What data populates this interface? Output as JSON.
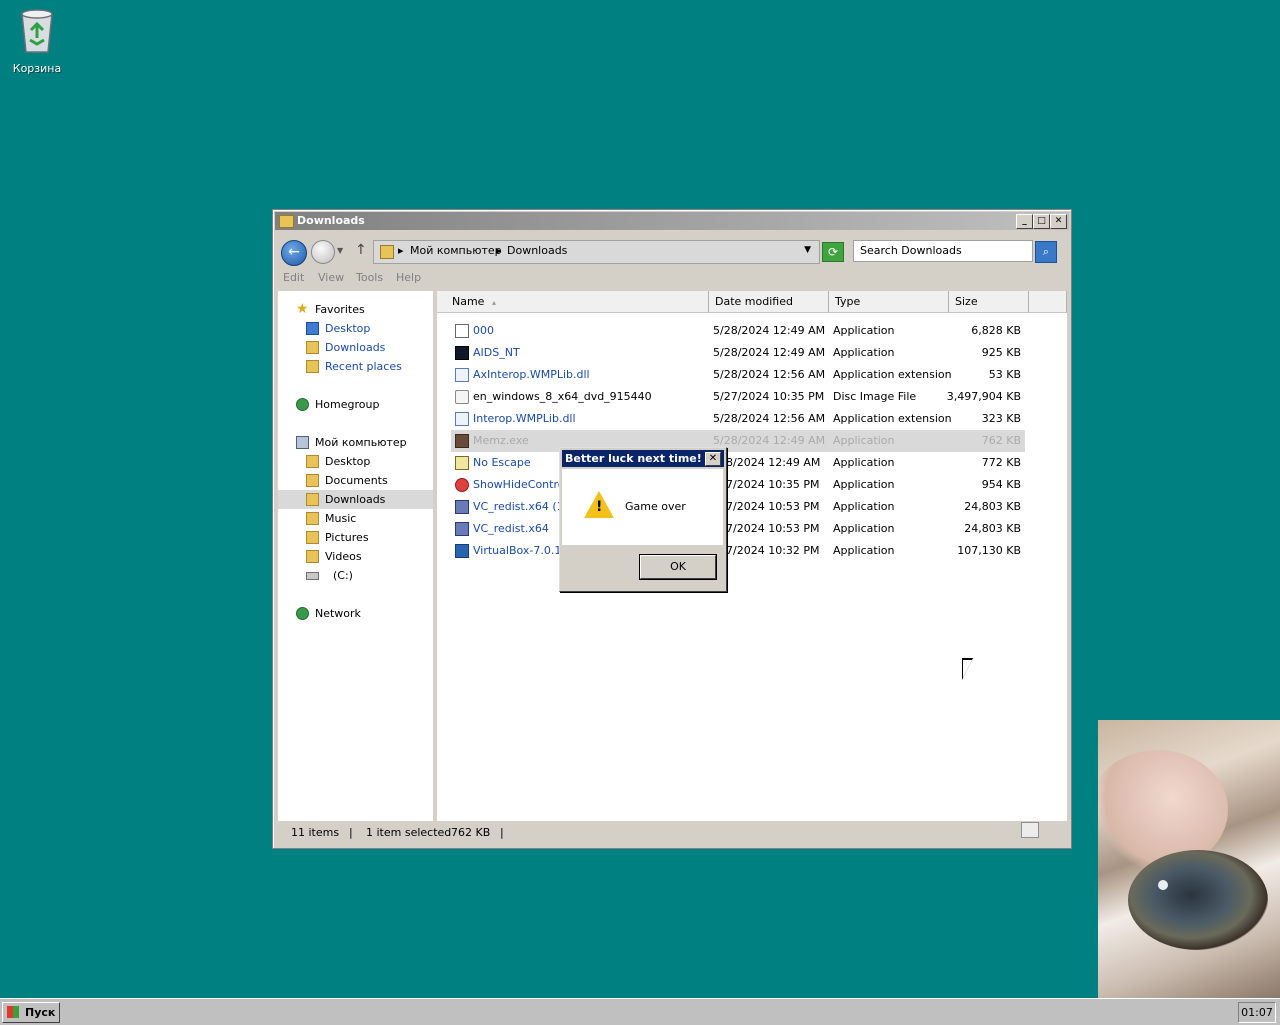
{
  "desktop": {
    "recycle_bin_label": "Корзина"
  },
  "window": {
    "title": "Downloads",
    "minimize": "_",
    "maximize": "□",
    "close": "✕",
    "address": {
      "crumb1": "Мой компьютер",
      "crumb2": "Downloads"
    },
    "search_placeholder": "Search Downloads",
    "menu": [
      "Edit",
      "View",
      "Tools",
      "Help"
    ]
  },
  "nav": {
    "favorites": "Favorites",
    "fav_items": [
      "Desktop",
      "Downloads",
      "Recent places"
    ],
    "homegroup": "Homegroup",
    "computer": "Мой компьютер",
    "computer_items": [
      "Desktop",
      "Documents",
      "Downloads",
      "Music",
      "Pictures",
      "Videos",
      "(C:)"
    ],
    "network": "Network"
  },
  "columns": {
    "name": "Name",
    "date": "Date modified",
    "type": "Type",
    "size": "Size"
  },
  "files": [
    {
      "name": "000",
      "date": "5/28/2024 12:49 AM",
      "type": "Application",
      "size": "6,828 KB",
      "icon": "app-icon"
    },
    {
      "name": "AIDS_NT",
      "date": "5/28/2024 12:49 AM",
      "type": "Application",
      "size": "925 KB",
      "icon": "dark-app-icon"
    },
    {
      "name": "AxInterop.WMPLib.dll",
      "date": "5/28/2024 12:56 AM",
      "type": "Application extension",
      "size": "53 KB",
      "icon": "dll-icon"
    },
    {
      "name": "en_windows_8_x64_dvd_915440",
      "date": "5/27/2024 10:35 PM",
      "type": "Disc Image File",
      "size": "3,497,904 KB",
      "icon": "disc-image-icon"
    },
    {
      "name": "Interop.WMPLib.dll",
      "date": "5/28/2024 12:56 AM",
      "type": "Application extension",
      "size": "323 KB",
      "icon": "dll-icon"
    },
    {
      "name": "Memz.exe",
      "date": "5/28/2024 12:49 AM",
      "type": "Application",
      "size": "762 KB",
      "icon": "image-app-icon"
    },
    {
      "name": "No Escape",
      "date": "28/2024 12:49 AM",
      "type": "Application",
      "size": "772 KB",
      "icon": "escape-icon"
    },
    {
      "name": "ShowHideControls",
      "date": "27/2024 10:35 PM",
      "type": "Application",
      "size": "954 KB",
      "icon": "red-circle-icon"
    },
    {
      "name": "VC_redist.x64 (1)",
      "date": "27/2024 10:53 PM",
      "type": "Application",
      "size": "24,803 KB",
      "icon": "installer-icon"
    },
    {
      "name": "VC_redist.x64",
      "date": "27/2024 10:53 PM",
      "type": "Application",
      "size": "24,803 KB",
      "icon": "installer-icon"
    },
    {
      "name": "VirtualBox-7.0.18-",
      "date": "27/2024 10:32 PM",
      "type": "Application",
      "size": "107,130 KB",
      "icon": "virtualbox-icon"
    }
  ],
  "status": {
    "count": "11 items",
    "selected": "1 item selected",
    "size": "762 KB"
  },
  "dialog": {
    "title": "Better luck next time!",
    "message": "Game over",
    "ok": "OK"
  },
  "taskbar": {
    "start": "Пуск",
    "clock": "01:07"
  }
}
